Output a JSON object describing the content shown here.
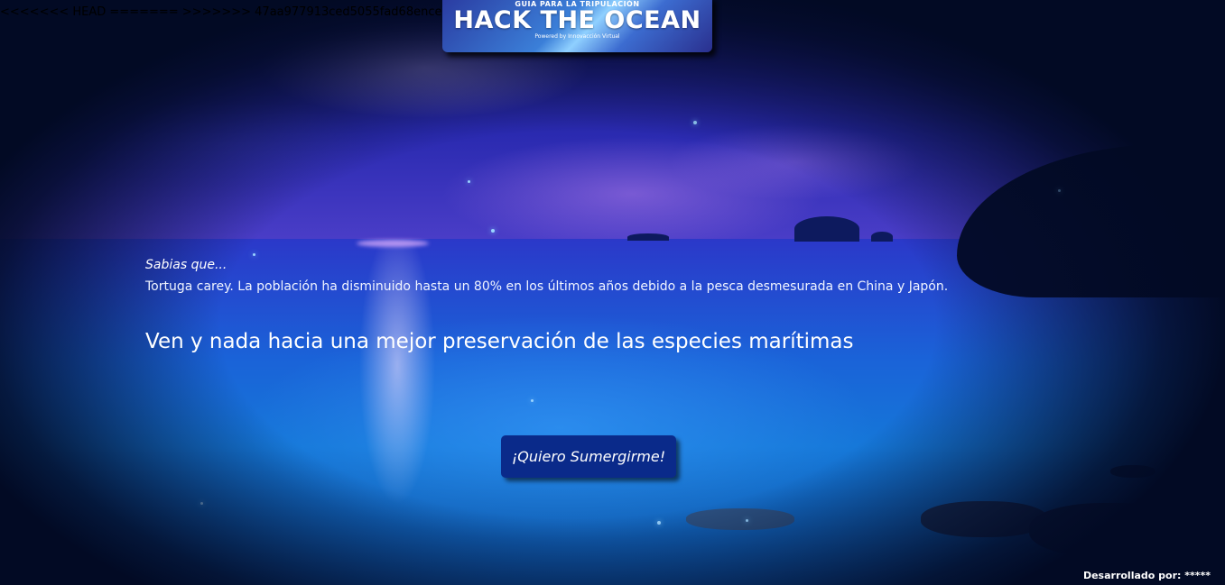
{
  "merge_conflict": {
    "text": "<<<<<<< HEAD ======= >>>>>>> 47aa977913ced5055fad68ence"
  },
  "logo": {
    "subtitle": "GUIA PARA LA TRIPULACIÓN",
    "title": "HACK THE OCEAN",
    "powered_by": "Powered by Innovacción Virtual"
  },
  "fact": {
    "heading": "Sabias que...",
    "body": "Tortuga carey. La población ha disminuido hasta un 80% en los últimos años debido a la pesca desmesurada en China y Japón."
  },
  "tagline": "Ven y nada hacia una mejor preservación de las especies marítimas",
  "cta": {
    "label": "¡Quiero Sumergirme!"
  },
  "footer": {
    "credit": "Desarrollado por: *****"
  },
  "colors": {
    "button_background": "#0a2a8a",
    "page_background": "#020b22",
    "text": "#ffffff"
  }
}
